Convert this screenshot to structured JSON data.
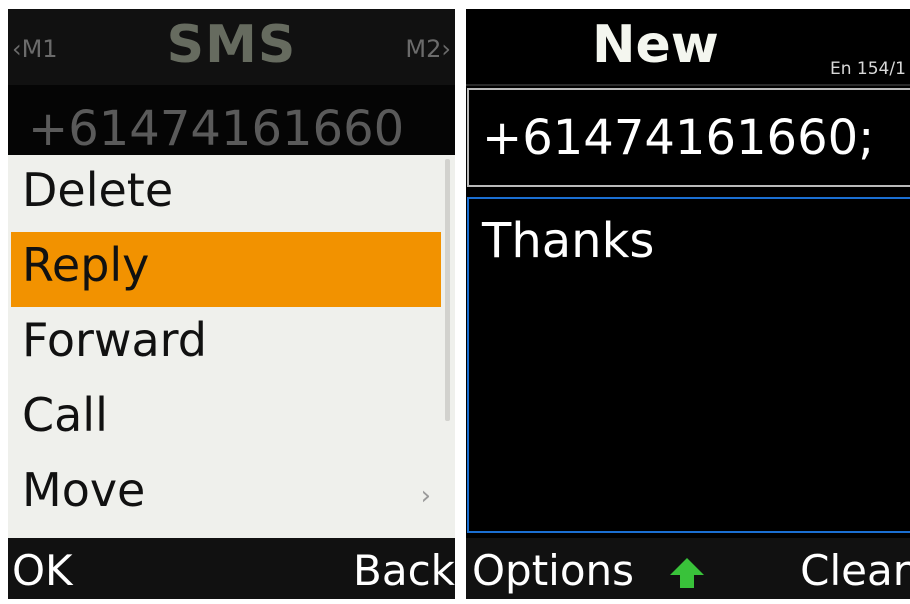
{
  "left": {
    "header": {
      "m1": "‹M1",
      "title": "SMS",
      "m2": "M2›"
    },
    "number": "+61474161660",
    "menu": {
      "items": [
        {
          "label": "Delete"
        },
        {
          "label": "Reply"
        },
        {
          "label": "Forward"
        },
        {
          "label": "Call"
        },
        {
          "label": "Move"
        }
      ],
      "selected_index": 1,
      "move_chevron": "›"
    },
    "softkeys": {
      "left": "OK",
      "right": "Back"
    }
  },
  "right": {
    "title": "New",
    "counter": "En 154/1",
    "recipient": "+61474161660;",
    "message": "Thanks",
    "softkeys": {
      "left": "Options",
      "center_icon": "up-arrow-icon",
      "right": "Clear"
    }
  },
  "colors": {
    "highlight": "#f29200",
    "menu_bg": "#eff0ec",
    "focus_border": "#1b6fd2",
    "arrow": "#39c23a"
  }
}
